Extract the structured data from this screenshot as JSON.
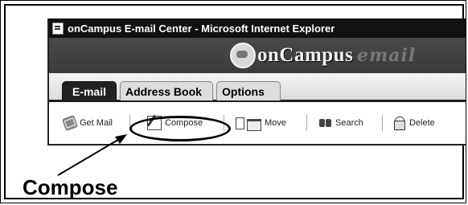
{
  "window": {
    "title": "onCampus E-mail Center - Microsoft Internet Explorer"
  },
  "banner": {
    "logo_text": "onCampus",
    "email_script": "email"
  },
  "tabs": [
    {
      "label": "E-mail",
      "active": true
    },
    {
      "label": "Address Book",
      "active": false
    },
    {
      "label": "Options",
      "active": false
    }
  ],
  "toolbar": {
    "get_mail": "Get Mail",
    "compose": "Compose",
    "move": "Move",
    "search": "Search",
    "delete": "Delete"
  },
  "annotation": {
    "label": "Compose"
  },
  "colors": {
    "titlebar": "#111111",
    "banner": "#3f3f3f",
    "active_tab": "#222222"
  }
}
